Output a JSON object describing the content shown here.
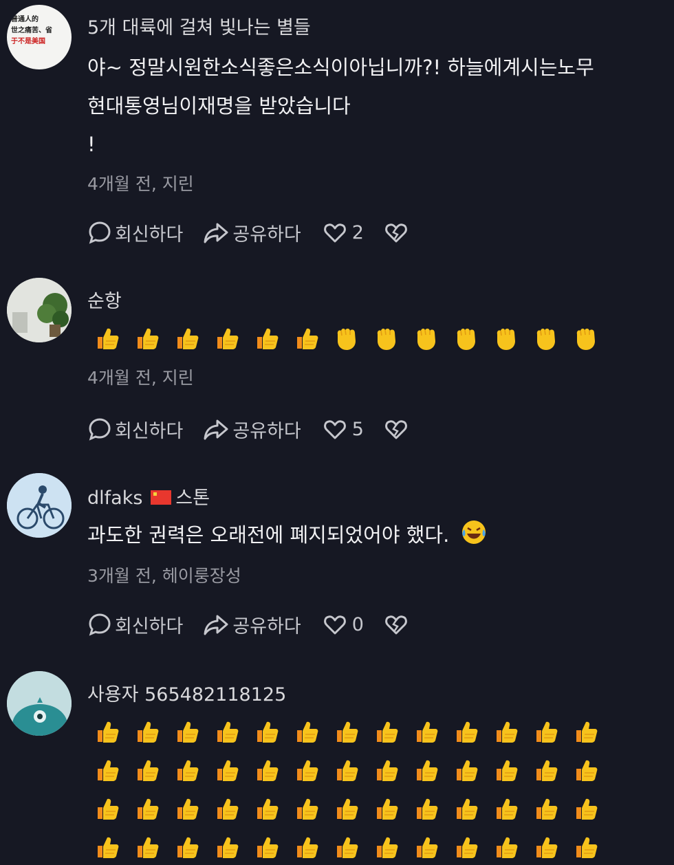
{
  "comments": [
    {
      "author": "5개 대륙에 걸쳐 빛나는 별들",
      "avatar_text": [
        "普通人的",
        "世之痛苦、省",
        "于不是美国"
      ],
      "text_lines": [
        "야~ 정말시원한소식좋은소식이아닙니까?! 하늘에계시는노무",
        "현대통영님이재명을 받았습니다",
        "  !"
      ],
      "meta": "4개월 전, 지린",
      "reply_label": "회신하다",
      "share_label": "공유하다",
      "likes": "2"
    },
    {
      "author": "순항",
      "emoji_rows": [
        [
          "thumbs-up",
          "thumbs-up",
          "thumbs-up",
          "thumbs-up",
          "thumbs-up",
          "thumbs-up",
          "fist",
          "fist",
          "fist",
          "fist",
          "fist",
          "fist",
          "fist"
        ]
      ],
      "meta": "4개월 전, 지린",
      "reply_label": "회신하다",
      "share_label": "공유하다",
      "likes": "5"
    },
    {
      "author": "dlfaks",
      "author_suffix": "스톤",
      "text": "과도한 권력은 오래전에 폐지되었어야 했다.",
      "meta": "3개월 전, 헤이룽장성",
      "reply_label": "회신하다",
      "share_label": "공유하다",
      "likes": "0"
    },
    {
      "author": "사용자 565482118125",
      "emoji_rows": [
        [
          "thumbs-up",
          "thumbs-up",
          "thumbs-up",
          "thumbs-up",
          "thumbs-up",
          "thumbs-up",
          "thumbs-up",
          "thumbs-up",
          "thumbs-up",
          "thumbs-up",
          "thumbs-up",
          "thumbs-up",
          "thumbs-up"
        ],
        [
          "thumbs-up",
          "thumbs-up",
          "thumbs-up",
          "thumbs-up",
          "thumbs-up",
          "thumbs-up",
          "thumbs-up",
          "thumbs-up",
          "thumbs-up",
          "thumbs-up",
          "thumbs-up",
          "thumbs-up",
          "thumbs-up"
        ],
        [
          "thumbs-up",
          "thumbs-up",
          "thumbs-up",
          "thumbs-up",
          "thumbs-up",
          "thumbs-up",
          "thumbs-up",
          "thumbs-up",
          "thumbs-up",
          "thumbs-up",
          "thumbs-up",
          "thumbs-up",
          "thumbs-up"
        ],
        [
          "thumbs-up",
          "thumbs-up",
          "thumbs-up",
          "thumbs-up",
          "thumbs-up",
          "thumbs-up",
          "thumbs-up",
          "thumbs-up",
          "thumbs-up",
          "thumbs-up",
          "thumbs-up",
          "thumbs-up",
          "thumbs-up"
        ]
      ]
    }
  ],
  "colors": {
    "background": "#161823",
    "text": "#f1f1f3",
    "meta": "#9a9ba3",
    "emoji": "#f7c31c"
  }
}
